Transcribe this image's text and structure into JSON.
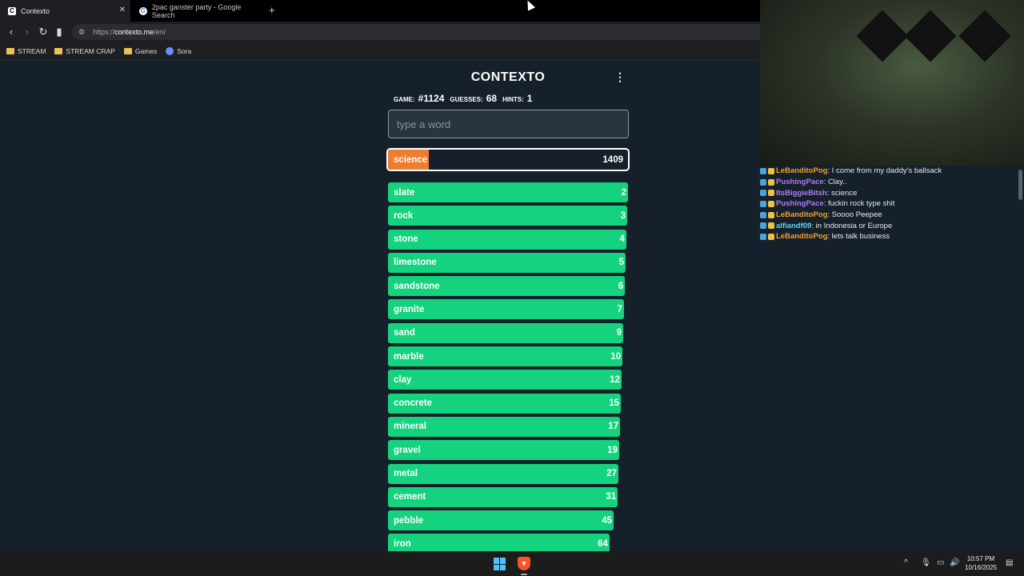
{
  "browser": {
    "tabs": [
      {
        "title": "Contexto",
        "favicon": "C"
      },
      {
        "title": "2pac ganster party - Google Search",
        "favicon": "G"
      }
    ],
    "url_prefix": "https://",
    "url_host": "contexto.me",
    "url_path": "/en/",
    "bookmarks": [
      "STREAM",
      "STREAM CRAP",
      "Games",
      "Sora"
    ]
  },
  "game": {
    "title": "CONTEXTO",
    "game_label": "GAME:",
    "game_number": "#1124",
    "guesses_label": "GUESSES:",
    "guesses": "68",
    "hints_label": "HINTS:",
    "hints": "1",
    "input_placeholder": "type a word",
    "current_guess": {
      "word": "science",
      "rank": "1409",
      "fill": 0.17
    },
    "guess_list": [
      {
        "word": "slate",
        "rank": "2",
        "fill": 1.0
      },
      {
        "word": "rock",
        "rank": "3",
        "fill": 0.997
      },
      {
        "word": "stone",
        "rank": "4",
        "fill": 0.993
      },
      {
        "word": "limestone",
        "rank": "5",
        "fill": 0.99
      },
      {
        "word": "sandstone",
        "rank": "6",
        "fill": 0.987
      },
      {
        "word": "granite",
        "rank": "7",
        "fill": 0.983
      },
      {
        "word": "sand",
        "rank": "9",
        "fill": 0.98
      },
      {
        "word": "marble",
        "rank": "10",
        "fill": 0.977
      },
      {
        "word": "clay",
        "rank": "12",
        "fill": 0.973
      },
      {
        "word": "concrete",
        "rank": "15",
        "fill": 0.97
      },
      {
        "word": "mineral",
        "rank": "17",
        "fill": 0.967
      },
      {
        "word": "gravel",
        "rank": "19",
        "fill": 0.963
      },
      {
        "word": "metal",
        "rank": "27",
        "fill": 0.96
      },
      {
        "word": "cement",
        "rank": "31",
        "fill": 0.957
      },
      {
        "word": "pebble",
        "rank": "45",
        "fill": 0.94
      },
      {
        "word": "iron",
        "rank": "64",
        "fill": 0.923
      }
    ]
  },
  "chat": [
    {
      "user": "LeBanditoPog",
      "color": "#f0a030",
      "msg": ": I come from my daddy's ballsack"
    },
    {
      "user": "PushingPace",
      "color": "#b07cf0",
      "msg": ": Clay.."
    },
    {
      "user": "ItsBiggieBitsh",
      "color": "#b07cf0",
      "msg": ": science"
    },
    {
      "user": "PushingPace",
      "color": "#b07cf0",
      "msg": ": fuckin rock type shit"
    },
    {
      "user": "LeBanditoPog",
      "color": "#f0a030",
      "msg": ": Soooo Peepee"
    },
    {
      "user": "alfiandf09",
      "color": "#5fd3f5",
      "msg": ": in Indonesia or Europe"
    },
    {
      "user": "LeBanditoPog",
      "color": "#f0a030",
      "msg": ": lets talk business"
    }
  ],
  "taskbar": {
    "time": "10:57 PM",
    "date": "10/16/2025"
  }
}
